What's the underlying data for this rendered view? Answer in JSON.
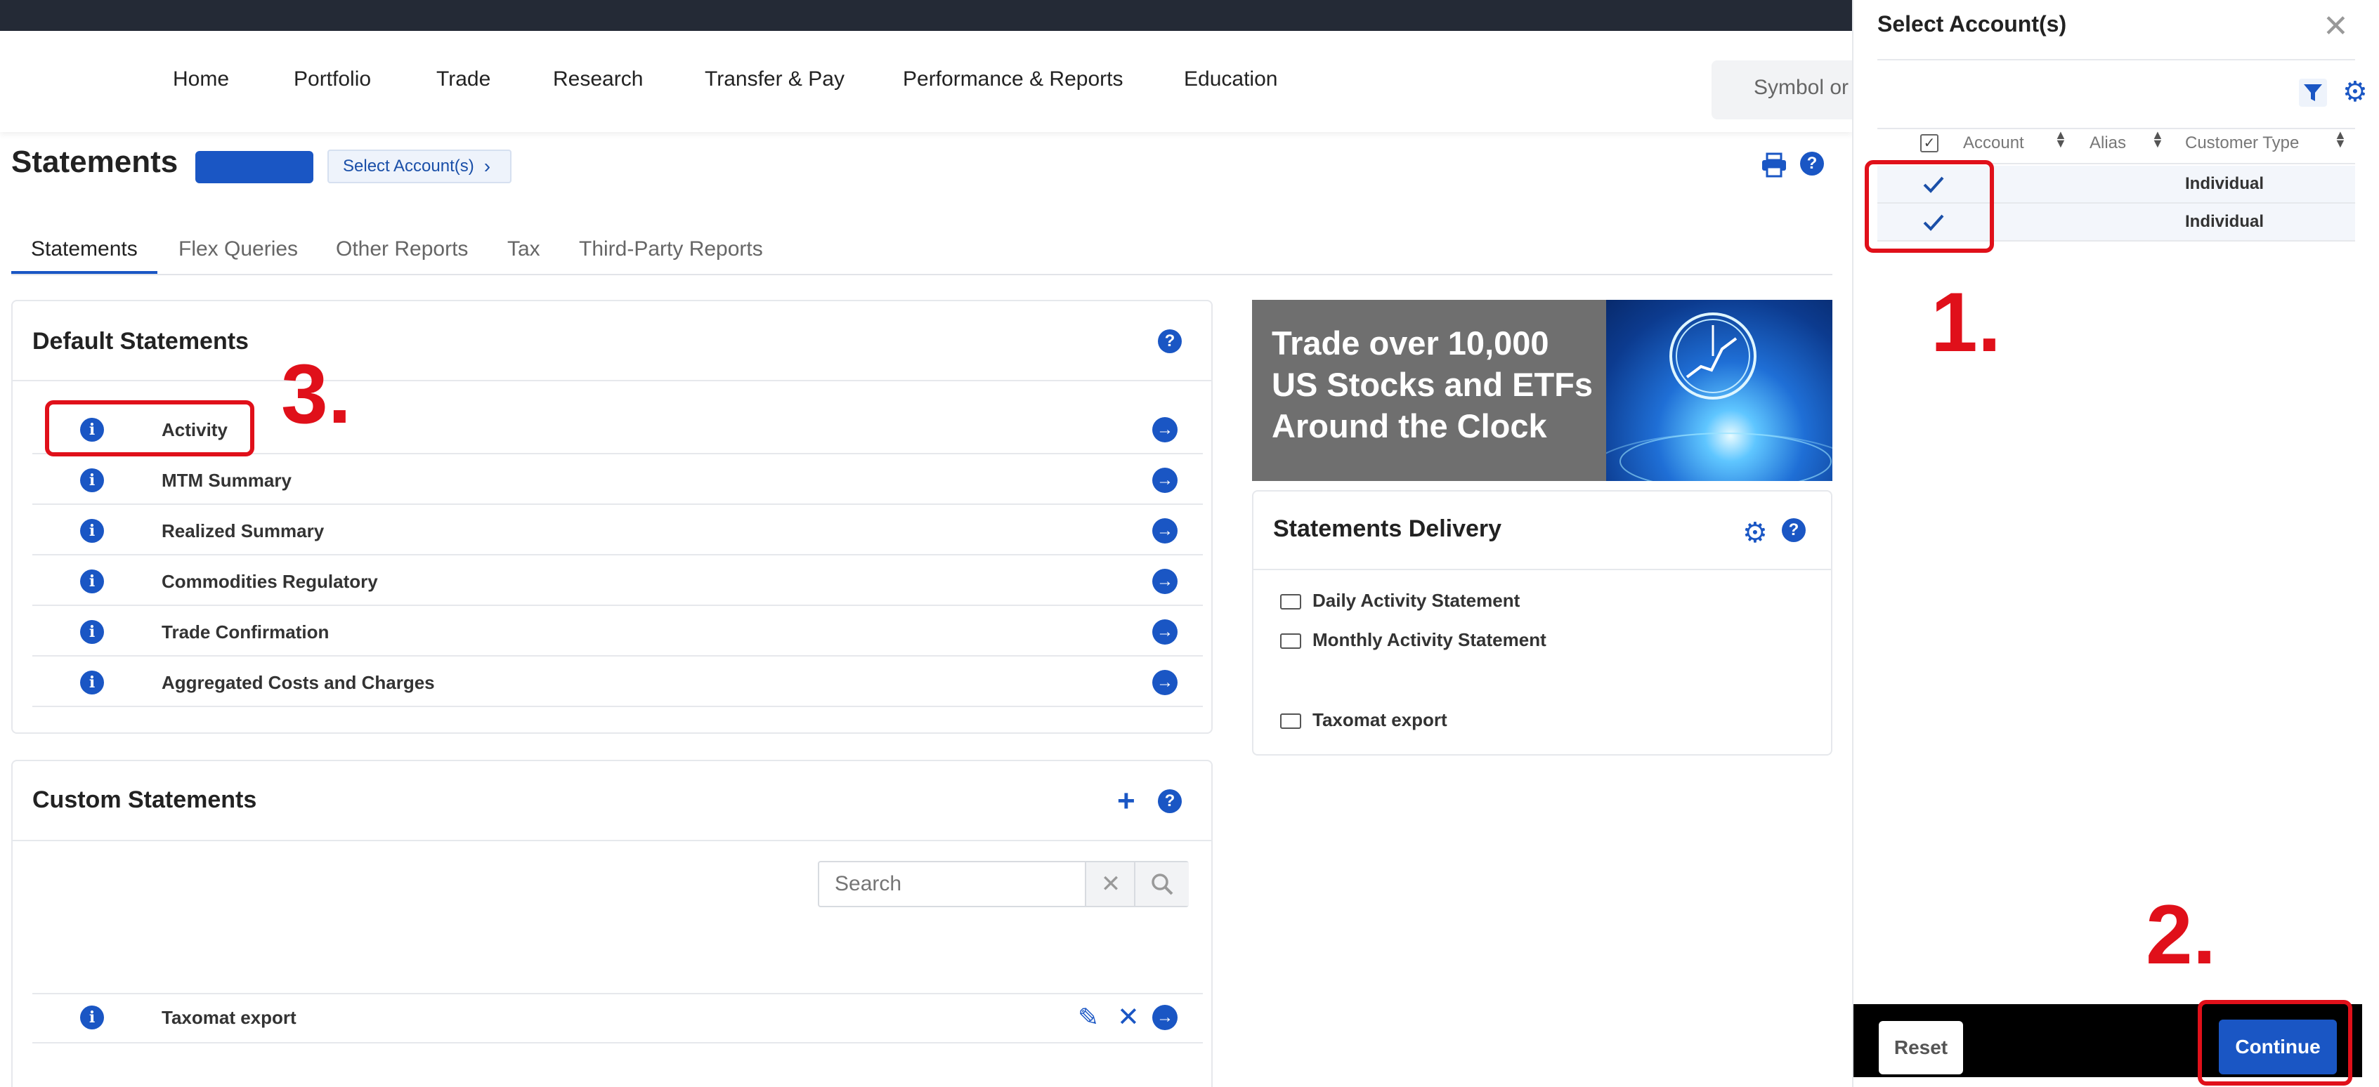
{
  "nav": {
    "items": [
      "Home",
      "Portfolio",
      "Trade",
      "Research",
      "Transfer & Pay",
      "Performance & Reports",
      "Education"
    ],
    "symbol_placeholder": "Symbol or"
  },
  "header": {
    "title": "Statements",
    "select_accounts_label": "Select Account(s)"
  },
  "tabs": [
    "Statements",
    "Flex Queries",
    "Other Reports",
    "Tax",
    "Third-Party Reports"
  ],
  "default_statements": {
    "title": "Default Statements",
    "items": [
      "Activity",
      "MTM Summary",
      "Realized Summary",
      "Commodities Regulatory",
      "Trade Confirmation",
      "Aggregated Costs and Charges"
    ]
  },
  "custom_statements": {
    "title": "Custom Statements",
    "search_placeholder": "Search",
    "items": [
      "Taxomat export"
    ]
  },
  "banner": {
    "text": "Trade over 10,000 US Stocks and ETFs Around the Clock"
  },
  "delivery": {
    "title": "Statements Delivery",
    "items": [
      "Daily Activity Statement",
      "Monthly Activity Statement",
      "Taxomat export"
    ]
  },
  "panel": {
    "title": "Select Account(s)",
    "columns": [
      "Account",
      "Alias",
      "Customer Type"
    ],
    "rows": [
      {
        "customer_type": "Individual"
      },
      {
        "customer_type": "Individual"
      }
    ],
    "reset_label": "Reset",
    "continue_label": "Continue"
  },
  "annotations": {
    "one": "1.",
    "two": "2.",
    "three": "3."
  },
  "colors": {
    "accent": "#1a56c4",
    "annotation_red": "#e0101a",
    "topbar": "#242a36"
  }
}
